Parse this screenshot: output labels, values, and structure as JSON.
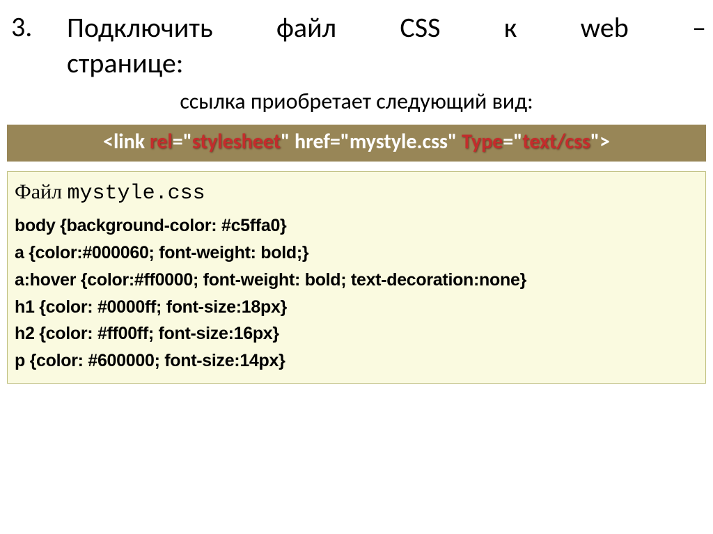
{
  "heading": {
    "number": "3.",
    "line1": "Подключить файл CSS к web –",
    "line2": "странице:"
  },
  "subheading": "ссылка приобретает следующий вид:",
  "link_code": {
    "p1": "<link ",
    "rel_attr": "rel",
    "p2": "=\"",
    "rel_val": "stylesheet",
    "p3": "\" href=\"mystyle.css\" ",
    "type_attr": "Type",
    "p4": "=\"",
    "type_val": "text/css",
    "p5": "\">"
  },
  "css_file": {
    "title_prefix": "Файл ",
    "filename": "mystyle.css",
    "lines": [
      "body {background-color: #c5ffa0}",
      "a {color:#000060; font-weight: bold;}",
      "a:hover {color:#ff0000; font-weight: bold; text-decoration:none}",
      "h1 {color: #0000ff; font-size:18px}",
      "h2 {color: #ff00ff; font-size:16px}",
      "p {color: #600000; font-size:14px}"
    ]
  }
}
